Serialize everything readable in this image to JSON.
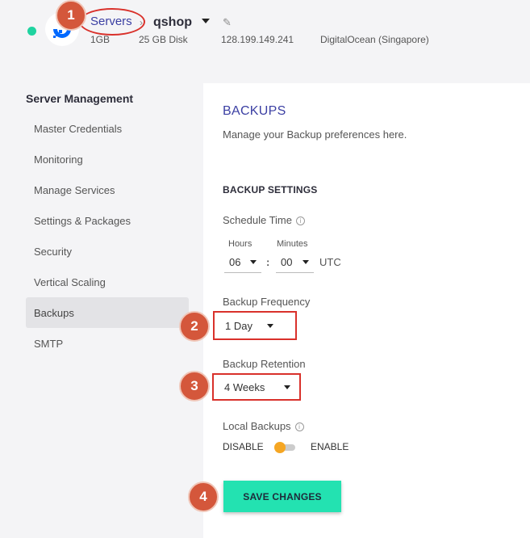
{
  "header": {
    "breadcrumb_servers": "Servers",
    "breadcrumb_sep": "›",
    "server_name": "qshop",
    "ram": "1GB",
    "disk": "25 GB Disk",
    "ip": "128.199.149.241",
    "provider": "DigitalOcean (Singapore)"
  },
  "sidebar": {
    "title": "Server Management",
    "items": [
      {
        "label": "Master Credentials"
      },
      {
        "label": "Monitoring"
      },
      {
        "label": "Manage Services"
      },
      {
        "label": "Settings & Packages"
      },
      {
        "label": "Security"
      },
      {
        "label": "Vertical Scaling"
      },
      {
        "label": "Backups"
      },
      {
        "label": "SMTP"
      }
    ],
    "active_index": 6
  },
  "panel": {
    "title": "BACKUPS",
    "subtitle": "Manage your Backup preferences here.",
    "section": "BACKUP SETTINGS",
    "schedule_label": "Schedule Time",
    "hours_label": "Hours",
    "minutes_label": "Minutes",
    "hours_value": "06",
    "minutes_value": "00",
    "time_colon": ":",
    "timezone": "UTC",
    "frequency_label": "Backup Frequency",
    "frequency_value": "1 Day",
    "retention_label": "Backup Retention",
    "retention_value": "4 Weeks",
    "local_label": "Local Backups",
    "disable_label": "DISABLE",
    "enable_label": "ENABLE",
    "local_enabled": false,
    "save_label": "SAVE CHANGES"
  },
  "annotations": {
    "badge1": "1",
    "badge2": "2",
    "badge3": "3",
    "badge4": "4"
  },
  "colors": {
    "accent": "#3b3fa3",
    "status": "#1fd3a0",
    "save_button": "#23e2b1",
    "toggle_knob": "#f5a623",
    "annotation": "#d4573b"
  },
  "icons": {
    "logo": "digitalocean-logo-icon",
    "edit": "pencil-icon",
    "info": "info-icon"
  }
}
